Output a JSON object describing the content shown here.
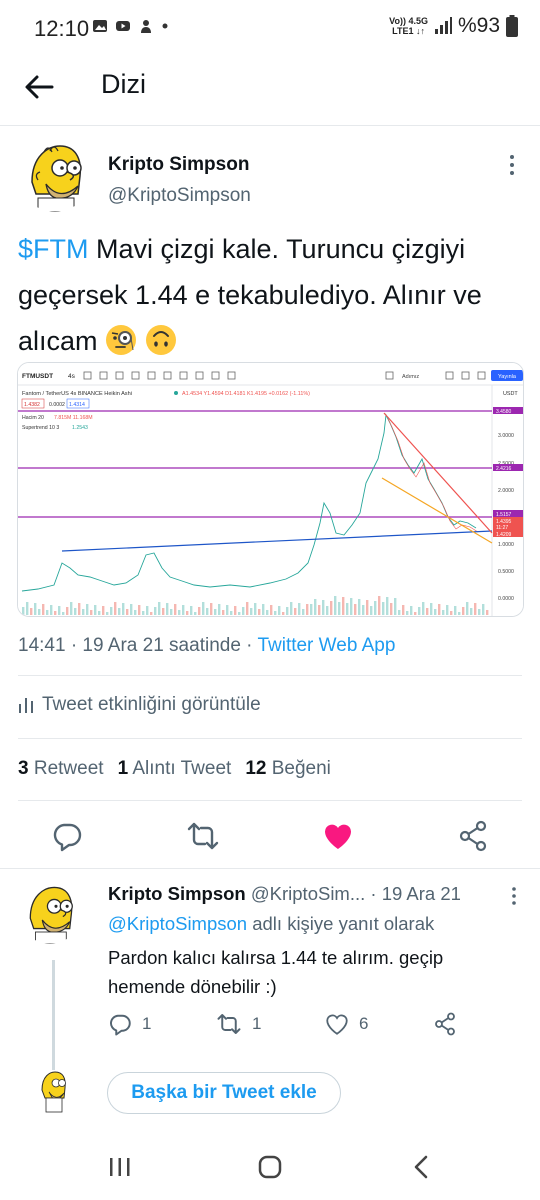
{
  "status_bar": {
    "time": "12:10",
    "network_top": "Vo)) 4.5G",
    "network_bottom": "LTE1 ↓↑",
    "battery": "%93"
  },
  "header": {
    "title": "Dizi"
  },
  "tweet": {
    "author_name": "Kripto Simpson",
    "author_handle": "@KriptoSimpson",
    "cashtag": "$FTM",
    "text": " Mavi çizgi kale. Turuncu çizgiyi geçersek 1.44 e tekabulediyo. Alınır ve alıcam ",
    "timestamp": "14:41 · 19 Ara 21 saatinde · ",
    "source": "Twitter Web App",
    "activity_label": "Tweet etkinliğini görüntüle",
    "retweets_count": "3",
    "retweets_label": "Retweet",
    "quotes_count": "1",
    "quotes_label": "Alıntı Tweet",
    "likes_count": "12",
    "likes_label": "Beğeni"
  },
  "chart_image": {
    "symbol": "FTMUSDT",
    "interval": "4s",
    "pair_title": "Fantom / TetherUS  4s  BINANCE  Heikin Ashi",
    "ohlc": "A1.4534 Y1.4594 D1.4181 K1.4195 +0.0162 (-1.11%)",
    "price_left": "1.4382",
    "change_mid": "0.0002",
    "price_right": "1.4314",
    "volume_label": "Hacim 20",
    "volume_values": "7.815M  11.168M",
    "supertrend_label": "Supertrend 10 3",
    "supertrend_value": "1.2543",
    "currency": "USDT",
    "publish_label": "Yayınla",
    "ind_label": "Adımız",
    "price_scale": [
      "3.0000",
      "2.5000",
      "2.0000",
      "1.5000",
      "1.0000",
      "0.5000",
      "0.0000"
    ],
    "price_tags": [
      "3.4580",
      "2.4216",
      "1.5157",
      "1.4395",
      "11:27",
      "1.4209"
    ]
  },
  "reply": {
    "author_name": "Kripto Simpson",
    "author_handle": "@KriptoSim...",
    "date": "· 19 Ara 21",
    "replying_mention": "@KriptoSimpson",
    "replying_suffix": " adlı kişiye yanıt olarak",
    "text": "Pardon kalıcı kalırsa 1.44 te alırım. geçip hemende dönebilir :)",
    "reply_count": "1",
    "retweet_count": "1",
    "like_count": "6"
  },
  "add_tweet_label": "Başka bir Tweet ekle",
  "colors": {
    "twitter_blue": "#1d9bf0",
    "like_pink": "#f91880",
    "text_gray": "#536471"
  }
}
